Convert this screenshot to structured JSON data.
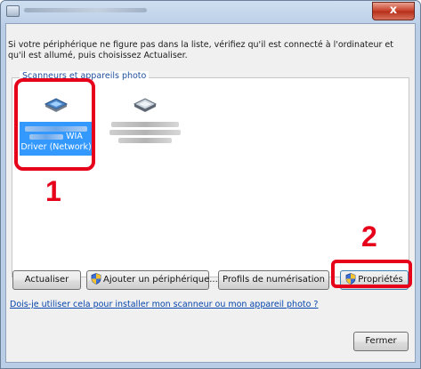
{
  "window": {
    "close_glyph": "x",
    "title_icon": "scanner-window-icon"
  },
  "instructions": "Si votre périphérique ne figure pas dans la liste, vérifiez qu'il est connecté à l'ordinateur et qu'il est allumé, puis choisissez Actualiser.",
  "group": {
    "label": "Scanneurs et appareils photo"
  },
  "devices": [
    {
      "name_suffix": "WIA",
      "name_line2": "Driver (Network)",
      "selected": true,
      "icon": "scanner-icon"
    },
    {
      "name_suffix": "",
      "selected": false,
      "icon": "scanner-icon"
    }
  ],
  "buttons": {
    "refresh": "Actualiser",
    "add_device": "Ajouter un périphérique...",
    "scan_profiles": "Profils de numérisation",
    "properties": "Propriétés",
    "close": "Fermer"
  },
  "help_link": "Dois-je utiliser cela pour installer mon scanneur ou mon appareil photo ?",
  "callouts": {
    "one": "1",
    "two": "2"
  },
  "colors": {
    "callout": "#e6001a",
    "selection": "#3399ff",
    "link": "#0645ad"
  }
}
